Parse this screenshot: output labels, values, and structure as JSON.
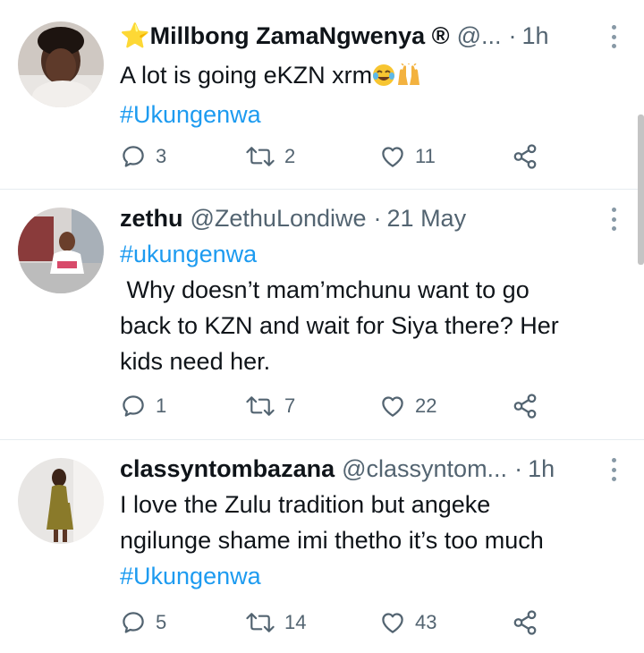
{
  "tweets": [
    {
      "name": "⭐Millbong ZamaNgwenya ®",
      "handle": "@...",
      "time": "1h",
      "lines": [
        "A lot is going eKZN xrm"
      ],
      "hashtag": "#Ukungenwa",
      "replies": "3",
      "retweets": "2",
      "likes": "11"
    },
    {
      "name": "zethu",
      "handle": "@ZethuLondiwe",
      "time": "21 May",
      "hashtag": "#ukungenwa",
      "lines": [
        " Why doesn’t mam’mchunu want to go",
        "back to KZN and wait for Siya there? Her",
        "kids need her."
      ],
      "replies": "1",
      "retweets": "7",
      "likes": "22"
    },
    {
      "name": "classyntombazana",
      "handle": "@classyntom...",
      "time": "1h",
      "lines": [
        "I love the Zulu tradition but angeke",
        "ngilunge shame imi thetho it’s too much"
      ],
      "hashtag": "#Ukungenwa",
      "replies": "5",
      "retweets": "14",
      "likes": "43"
    }
  ],
  "icons": {
    "reply": "reply-icon",
    "retweet": "retweet-icon",
    "like": "heart-icon",
    "share": "share-icon",
    "more": "more-vertical-icon",
    "emoji": [
      "tears-of-joy-emoji",
      "raising-hands-emoji"
    ]
  },
  "colors": {
    "hashtag": "#1d9bf0",
    "secondary_text": "#536471",
    "divider": "#e6ecf0"
  }
}
